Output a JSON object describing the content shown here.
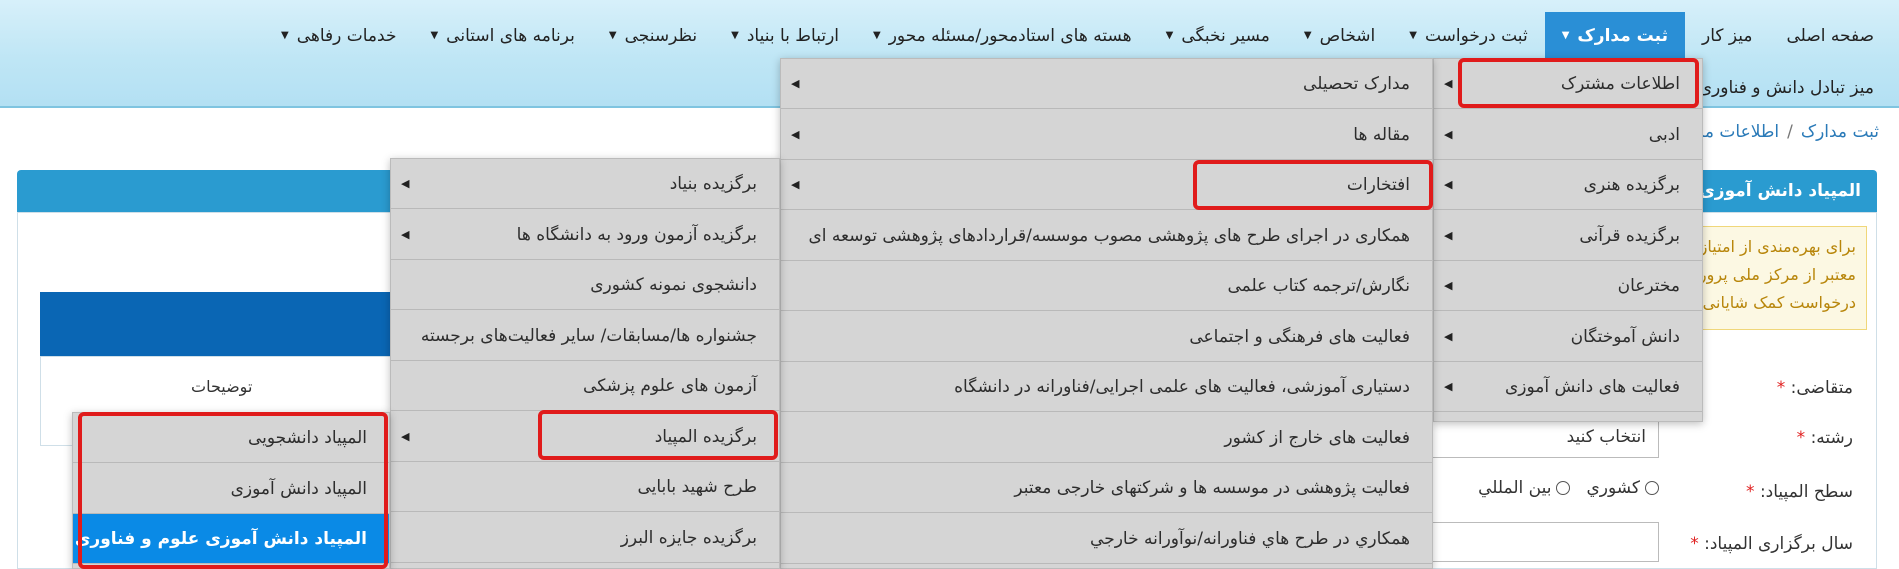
{
  "nav": {
    "row1": [
      {
        "label": "صفحه اصلی",
        "dropdown": false
      },
      {
        "label": "میز کار",
        "dropdown": false
      },
      {
        "label": "ثبت مدارک",
        "dropdown": true,
        "active": true
      },
      {
        "label": "ثبت درخواست",
        "dropdown": true
      },
      {
        "label": "اشخاص",
        "dropdown": true
      },
      {
        "label": "مسیر نخبگی",
        "dropdown": true
      },
      {
        "label": "هسته های استادمحور/مسئله محور",
        "dropdown": true
      },
      {
        "label": "ارتباط با بنیاد",
        "dropdown": true
      },
      {
        "label": "نظرسنجی",
        "dropdown": true
      },
      {
        "label": "برنامه های استانی",
        "dropdown": true
      },
      {
        "label": "خدمات رفاهی",
        "dropdown": true
      }
    ],
    "row2": [
      {
        "label": "میز تبادل دانش و فناوری",
        "dropdown": false
      }
    ]
  },
  "breadcrumb": [
    "ثبت مدارک",
    "اطلاعات مشت"
  ],
  "panel_title": "المپیاد دانش آموزی",
  "alert_text": [
    "برای بهره‌مندی از امتیاز",
    "معتبر از مرکز ملی پرورش",
    "درخواست کمک شایانی"
  ],
  "form": {
    "applicant_label": "متقاضی:",
    "field_label": "رشته:",
    "field_value": "انتخاب کنید",
    "level_label": "سطح المپیاد:",
    "level_options": [
      "کشوري",
      "بين المللي"
    ],
    "year_label": "سال برگزاری المپیاد:",
    "required_mark": "*"
  },
  "table": {
    "col_desc": "توضیحات"
  },
  "menu1": [
    {
      "label": "اطلاعات مشترک",
      "arrow": true
    },
    {
      "label": "ادبی",
      "arrow": true
    },
    {
      "label": "برگزیده هنری",
      "arrow": true
    },
    {
      "label": "برگزیده قرآنی",
      "arrow": true
    },
    {
      "label": "مخترعان",
      "arrow": true
    },
    {
      "label": "دانش آموختگان",
      "arrow": true
    },
    {
      "label": "فعالیت های دانش آموزی",
      "arrow": true
    }
  ],
  "menu2": [
    {
      "label": "مدارک تحصیلی",
      "arrow": true
    },
    {
      "label": "مقاله ها",
      "arrow": true
    },
    {
      "label": "افتخارات",
      "arrow": true
    },
    {
      "label": "همکاری در اجرای طرح های پژوهشی مصوب موسسه/قراردادهای پژوهشی توسعه ای",
      "arrow": false
    },
    {
      "label": "نگارش/ترجمه کتاب علمی",
      "arrow": false
    },
    {
      "label": "فعالیت های فرهنگی و اجتماعی",
      "arrow": false
    },
    {
      "label": "دستیاری آموزشی، فعالیت های علمی اجرایی/فناورانه در دانشگاه",
      "arrow": false
    },
    {
      "label": "فعالیت های خارج از کشور",
      "arrow": false
    },
    {
      "label": "فعالیت پژوهشی در موسسه ها و شرکتهای خارجی معتبر",
      "arrow": false
    },
    {
      "label": "همکاري در طرح هاي فناورانه/نوآورانه خارجي",
      "arrow": false
    }
  ],
  "menu3": [
    {
      "label": "برگزیده بنیاد",
      "arrow": true
    },
    {
      "label": "برگزیده آزمون ورود به دانشگاه ها",
      "arrow": true
    },
    {
      "label": "دانشجوی نمونه کشوری",
      "arrow": false
    },
    {
      "label": "جشنواره ها/مسابقات/ سایر فعالیت‌های برجسته",
      "arrow": false
    },
    {
      "label": "آزمون های علوم پزشکی",
      "arrow": false
    },
    {
      "label": "برگزیده المپیاد",
      "arrow": true
    },
    {
      "label": "طرح شهید بابایی",
      "arrow": false
    },
    {
      "label": "برگزیده جایزه البرز",
      "arrow": false
    }
  ],
  "menu4": [
    {
      "label": "المپیاد دانشجویی",
      "selected": false
    },
    {
      "label": "المپیاد دانش آموزی",
      "selected": false
    },
    {
      "label": "المپیاد دانش آموزی علوم و فناوری نانو",
      "selected": true
    }
  ],
  "colors": {
    "nav_active": "#2a8fd6",
    "panel_header": "#2a9bd0",
    "highlight": "#e01b1b",
    "menu_selected": "#0a8ae6"
  }
}
